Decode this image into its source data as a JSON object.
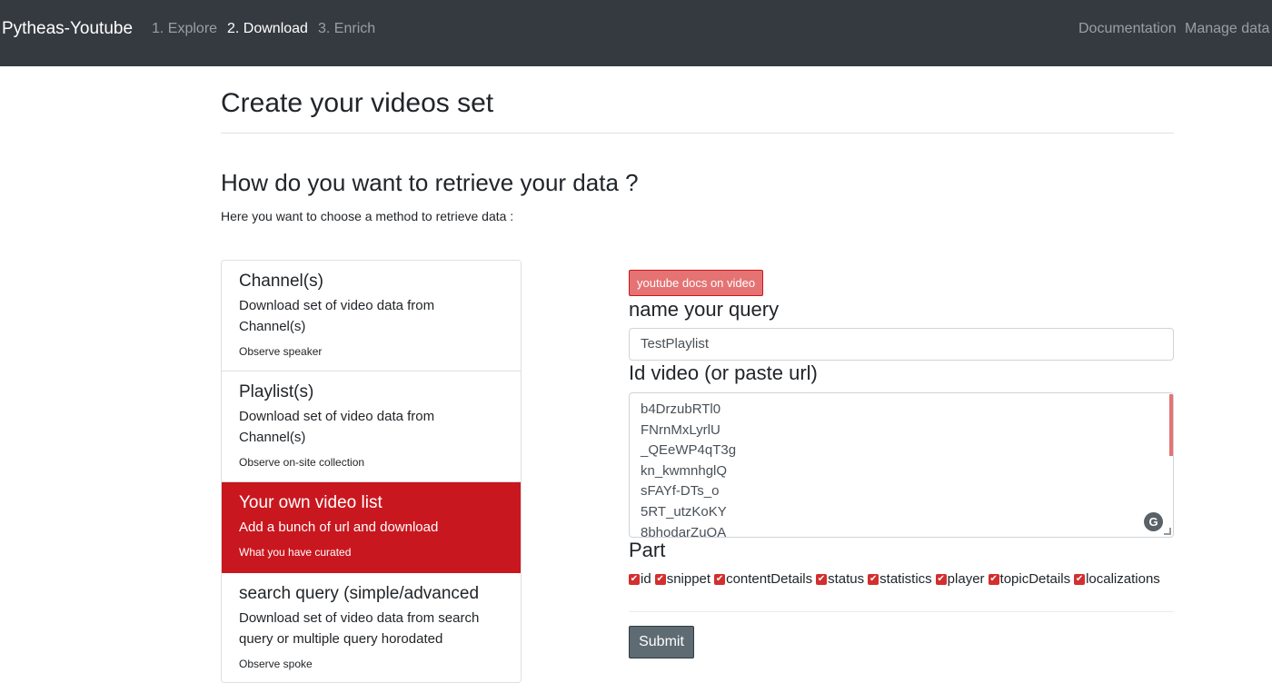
{
  "navbar": {
    "brand": "Pytheas-Youtube",
    "steps": [
      "1. Explore",
      "2. Download",
      "3. Enrich"
    ],
    "right_links": [
      "Documentation",
      "Manage data"
    ]
  },
  "page": {
    "title": "Create your videos set",
    "section_title": "How do you want to retrieve your data ?",
    "section_desc": "Here you want to choose a method to retrieve data :"
  },
  "methods": [
    {
      "title": "Channel(s)",
      "desc": "Download set of video data from Channel(s)",
      "note": "Observe speaker"
    },
    {
      "title": "Playlist(s)",
      "desc": "Download set of video data from Channel(s)",
      "note": "Observe on-site collection"
    },
    {
      "title": "Your own video list",
      "desc": "Add a bunch of url and download",
      "note": "What you have curated"
    },
    {
      "title": "search query (simple/advanced",
      "desc": "Download set of video data from search query or multiple query horodated",
      "note": "Observe spoke"
    }
  ],
  "form": {
    "docs_badge": "youtube docs on video",
    "name_label": "name your query",
    "name_value": "TestPlaylist",
    "ids_label": "Id video (or paste url)",
    "ids_lines": [
      "b4DrzubRTl0",
      "FNrnMxLyrlU",
      "_QEeWP4qT3g",
      "kn_kwmnhglQ",
      "sFAYf-DTs_o",
      "5RT_utzKoKY",
      "8bhodarZuQA"
    ],
    "part_label": "Part",
    "parts": [
      "id",
      "snippet",
      "contentDetails",
      "status",
      "statistics",
      "player",
      "topicDetails",
      "localizations"
    ],
    "submit_label": "Submit"
  },
  "colors": {
    "navbar_bg": "#343a40",
    "accent_red": "#c9171f",
    "badge_bg": "#e57373"
  }
}
